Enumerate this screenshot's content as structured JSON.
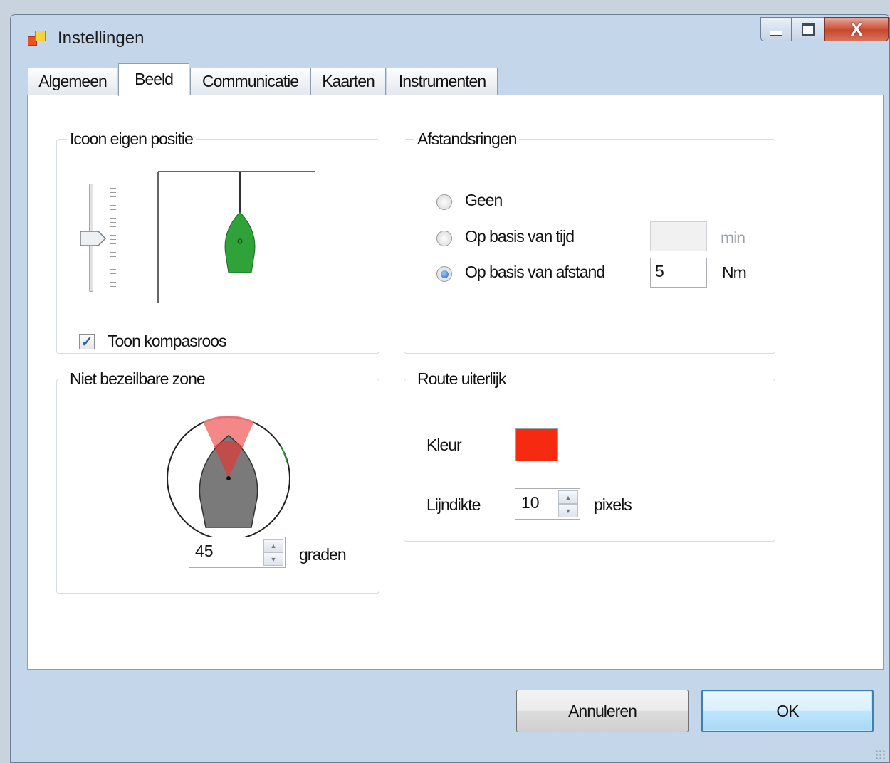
{
  "window": {
    "title": "Instellingen",
    "controls": {
      "minimize": "minimize-icon",
      "maximize": "maximize-icon",
      "close": "close-icon"
    }
  },
  "tabs": [
    {
      "label": "Algemeen",
      "active": false
    },
    {
      "label": "Beeld",
      "active": true
    },
    {
      "label": "Communicatie",
      "active": false
    },
    {
      "label": "Kaarten",
      "active": false
    },
    {
      "label": "Instrumenten",
      "active": false
    }
  ],
  "icon_position": {
    "legend": "Icoon eigen positie",
    "show_compass_label": "Toon kompasroos",
    "show_compass_checked": true
  },
  "distance_rings": {
    "legend": "Afstandsringen",
    "options": [
      {
        "label": "Geen",
        "selected": false
      },
      {
        "label": "Op basis van tijd",
        "selected": false
      },
      {
        "label": "Op basis van afstand",
        "selected": true
      }
    ],
    "time_value": "",
    "time_unit": "min",
    "distance_value": "5",
    "distance_unit": "Nm"
  },
  "no_sail_zone": {
    "legend": "Niet bezeilbare zone",
    "angle_value": "45",
    "angle_unit": "graden"
  },
  "route_appearance": {
    "legend": "Route uiterlijk",
    "color_label": "Kleur",
    "color": "#f52a10",
    "line_width_label": "Lijndikte",
    "line_width_value": "10",
    "line_width_unit": "pixels"
  },
  "footer": {
    "cancel_label": "Annuleren",
    "ok_label": "OK"
  }
}
